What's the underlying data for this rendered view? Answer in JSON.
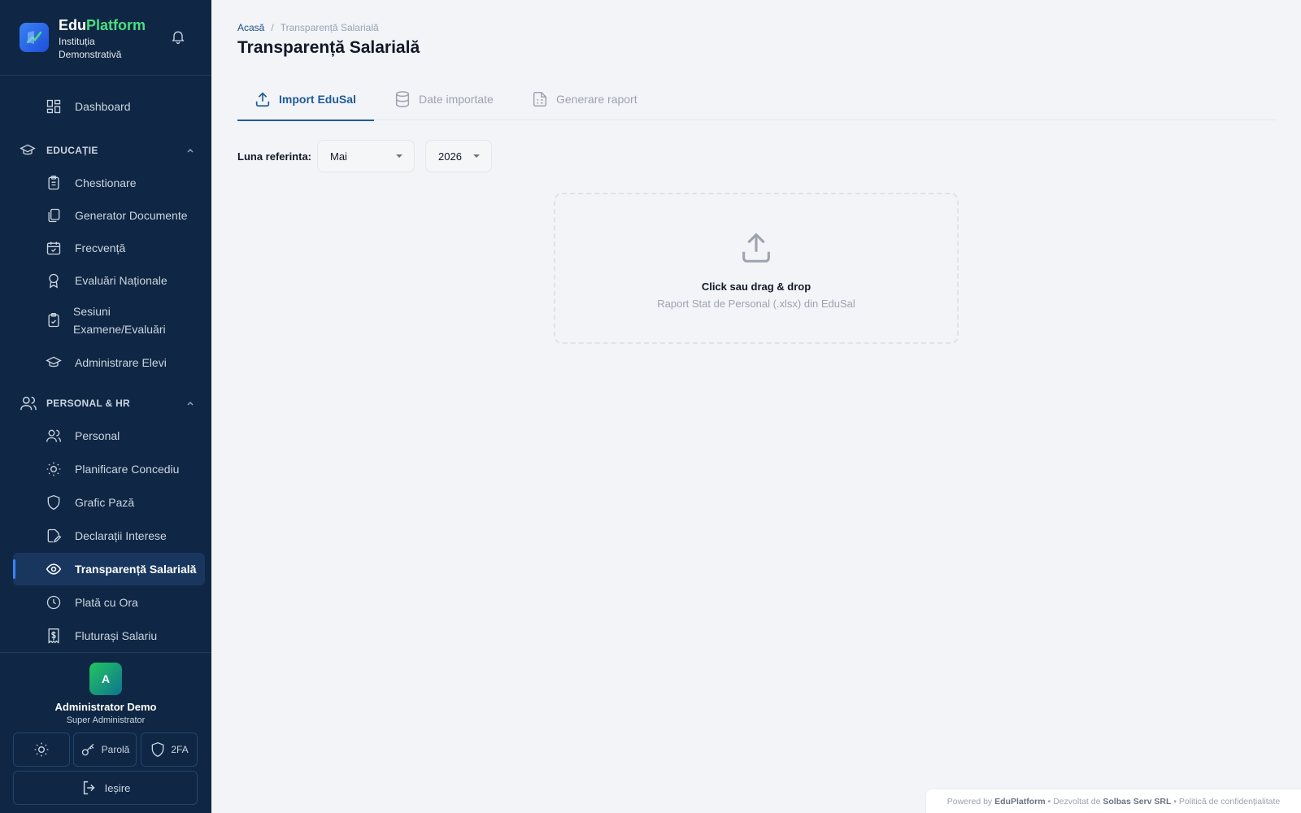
{
  "brand": {
    "name_part1": "Edu",
    "name_part2": "Platform",
    "subtitle": "Instituția Demonstrativă"
  },
  "sidebar": {
    "dashboard": "Dashboard",
    "sections": {
      "education": "EDUCAȚIE",
      "hr": "PERSONAL & HR"
    },
    "education_items": [
      "Chestionare",
      "Generator Documente",
      "Frecvență",
      "Evaluări Naționale",
      "Sesiuni Examene/Evaluări",
      "Administrare Elevi"
    ],
    "hr_items": [
      "Personal",
      "Planificare Concediu",
      "Grafic Pază",
      "Declarații Interese",
      "Transparență Salarială",
      "Plată cu Ora",
      "Fluturași Salariu"
    ]
  },
  "user": {
    "initial": "A",
    "name": "Administrator Demo",
    "role": "Super Administrator",
    "password_label": "Parolă",
    "twofa_label": "2FA",
    "logout_label": "Ieșire"
  },
  "breadcrumb": {
    "home": "Acasă",
    "sep": "/",
    "current": "Transparență Salarială"
  },
  "page": {
    "title": "Transparență Salarială"
  },
  "tabs": [
    {
      "label": "Import EduSal",
      "active": true
    },
    {
      "label": "Date importate",
      "active": false
    },
    {
      "label": "Generare raport",
      "active": false
    }
  ],
  "filter": {
    "label": "Luna referinta:",
    "month": "Mai",
    "year": "2026"
  },
  "dropzone": {
    "title": "Click sau drag & drop",
    "subtitle": "Raport Stat de Personal (.xlsx) din EduSal"
  },
  "footer": {
    "powered": "Powered by",
    "brand": "EduPlatform",
    "dot1": "•",
    "dev": "Dezvoltat de",
    "company": "Solbas Serv SRL",
    "dot2": "•",
    "privacy": "Politică de confidențialitate"
  },
  "colors": {
    "sidebar_bg": "#0f2744",
    "accent": "#1e5b9a",
    "brand_green": "#4ade80"
  }
}
